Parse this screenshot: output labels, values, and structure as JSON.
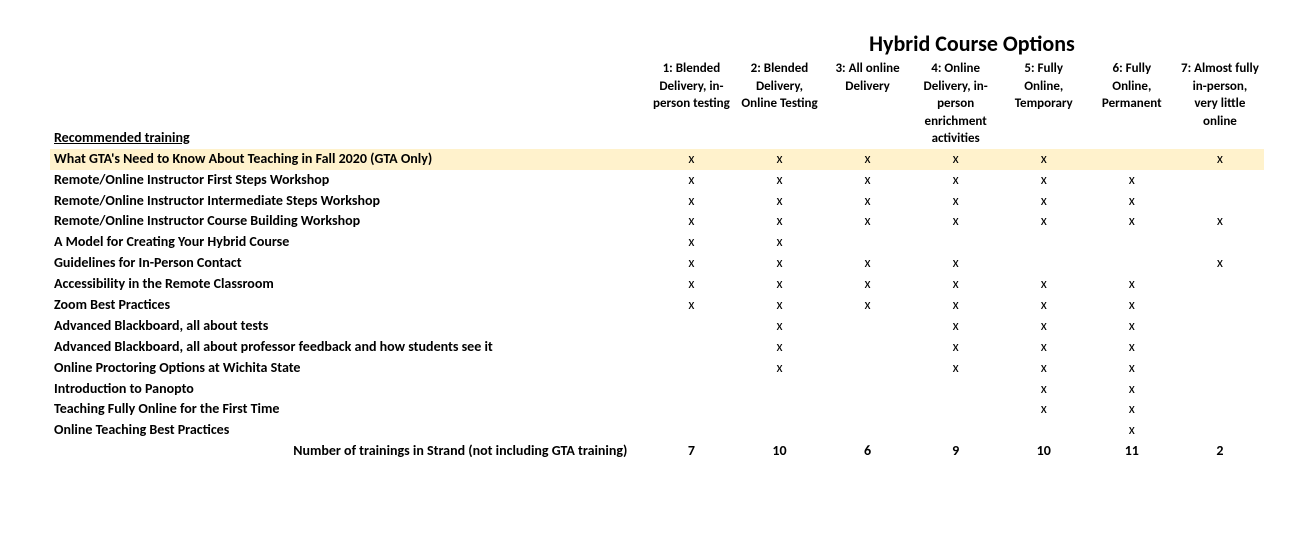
{
  "super_header": "Hybrid Course Options",
  "section_title": "Recommended training",
  "columns": [
    "1: Blended Delivery, in-person testing",
    "2: Blended Delivery, Online Testing",
    "3: All online Delivery",
    "4: Online Delivery, in-person enrichment activities",
    "5: Fully Online, Temporary",
    "6: Fully Online, Permanent",
    "7: Almost fully in-person, very little online"
  ],
  "rows": [
    {
      "label": "What GTA's Need to Know About Teaching in Fall 2020 (GTA Only)",
      "highlight": true,
      "marks": [
        "x",
        "x",
        "x",
        "x",
        "x",
        "",
        "x"
      ]
    },
    {
      "label": "Remote/Online Instructor First Steps Workshop",
      "highlight": false,
      "marks": [
        "x",
        "x",
        "x",
        "x",
        "x",
        "x",
        ""
      ]
    },
    {
      "label": "Remote/Online Instructor Intermediate Steps Workshop",
      "highlight": false,
      "marks": [
        "x",
        "x",
        "x",
        "x",
        "x",
        "x",
        ""
      ]
    },
    {
      "label": "Remote/Online Instructor Course Building Workshop",
      "highlight": false,
      "marks": [
        "x",
        "x",
        "x",
        "x",
        "x",
        "x",
        "x"
      ]
    },
    {
      "label": "A Model for Creating Your Hybrid Course",
      "highlight": false,
      "marks": [
        "x",
        "x",
        "",
        "",
        "",
        "",
        ""
      ]
    },
    {
      "label": "Guidelines for In-Person Contact",
      "highlight": false,
      "marks": [
        "x",
        "x",
        "x",
        "x",
        "",
        "",
        "x"
      ]
    },
    {
      "label": "Accessibility in the Remote Classroom",
      "highlight": false,
      "marks": [
        "x",
        "x",
        "x",
        "x",
        "x",
        "x",
        ""
      ]
    },
    {
      "label": "Zoom Best Practices",
      "highlight": false,
      "marks": [
        "x",
        "x",
        "x",
        "x",
        "x",
        "x",
        ""
      ]
    },
    {
      "label": "Advanced Blackboard, all about tests",
      "highlight": false,
      "marks": [
        "",
        "x",
        "",
        "x",
        "x",
        "x",
        ""
      ]
    },
    {
      "label": "Advanced Blackboard, all about professor feedback and how students see it",
      "highlight": false,
      "marks": [
        "",
        "x",
        "",
        "x",
        "x",
        "x",
        ""
      ]
    },
    {
      "label": "Online Proctoring Options at Wichita State",
      "highlight": false,
      "marks": [
        "",
        "x",
        "",
        "x",
        "x",
        "x",
        ""
      ]
    },
    {
      "label": "Introduction to Panopto",
      "highlight": false,
      "marks": [
        "",
        "",
        "",
        "",
        "x",
        "x",
        ""
      ]
    },
    {
      "label": "Teaching Fully Online for the First Time",
      "highlight": false,
      "marks": [
        "",
        "",
        "",
        "",
        "x",
        "x",
        ""
      ]
    },
    {
      "label": "Online Teaching Best Practices",
      "highlight": false,
      "marks": [
        "",
        "",
        "",
        "",
        "",
        "x",
        ""
      ]
    }
  ],
  "totals": {
    "label": "Number of trainings in Strand (not including GTA training)",
    "values": [
      "7",
      "10",
      "6",
      "9",
      "10",
      "11",
      "2"
    ]
  },
  "chart_data": {
    "type": "table",
    "title": "Recommended training vs Hybrid Course Options",
    "columns": [
      "1: Blended Delivery, in-person testing",
      "2: Blended Delivery, Online Testing",
      "3: All online Delivery",
      "4: Online Delivery, in-person enrichment activities",
      "5: Fully Online, Temporary",
      "6: Fully Online, Permanent",
      "7: Almost fully in-person, very little online"
    ],
    "rows": [
      "What GTA's Need to Know About Teaching in Fall 2020 (GTA Only)",
      "Remote/Online Instructor First Steps Workshop",
      "Remote/Online Instructor Intermediate Steps Workshop",
      "Remote/Online Instructor Course Building Workshop",
      "A Model for Creating Your Hybrid Course",
      "Guidelines for In-Person Contact",
      "Accessibility in the Remote Classroom",
      "Zoom Best Practices",
      "Advanced Blackboard, all about tests",
      "Advanced Blackboard, all about professor feedback and how students see it",
      "Online Proctoring Options at Wichita State",
      "Introduction to Panopto",
      "Teaching Fully Online for the First Time",
      "Online Teaching Best Practices"
    ],
    "matrix": [
      [
        1,
        1,
        1,
        1,
        1,
        0,
        1
      ],
      [
        1,
        1,
        1,
        1,
        1,
        1,
        0
      ],
      [
        1,
        1,
        1,
        1,
        1,
        1,
        0
      ],
      [
        1,
        1,
        1,
        1,
        1,
        1,
        1
      ],
      [
        1,
        1,
        0,
        0,
        0,
        0,
        0
      ],
      [
        1,
        1,
        1,
        1,
        0,
        0,
        1
      ],
      [
        1,
        1,
        1,
        1,
        1,
        1,
        0
      ],
      [
        1,
        1,
        1,
        1,
        1,
        1,
        0
      ],
      [
        0,
        1,
        0,
        1,
        1,
        1,
        0
      ],
      [
        0,
        1,
        0,
        1,
        1,
        1,
        0
      ],
      [
        0,
        1,
        0,
        1,
        1,
        1,
        0
      ],
      [
        0,
        0,
        0,
        0,
        1,
        1,
        0
      ],
      [
        0,
        0,
        0,
        0,
        1,
        1,
        0
      ],
      [
        0,
        0,
        0,
        0,
        0,
        1,
        0
      ]
    ],
    "column_totals_excluding_first_row": [
      7,
      10,
      6,
      9,
      10,
      11,
      2
    ]
  }
}
